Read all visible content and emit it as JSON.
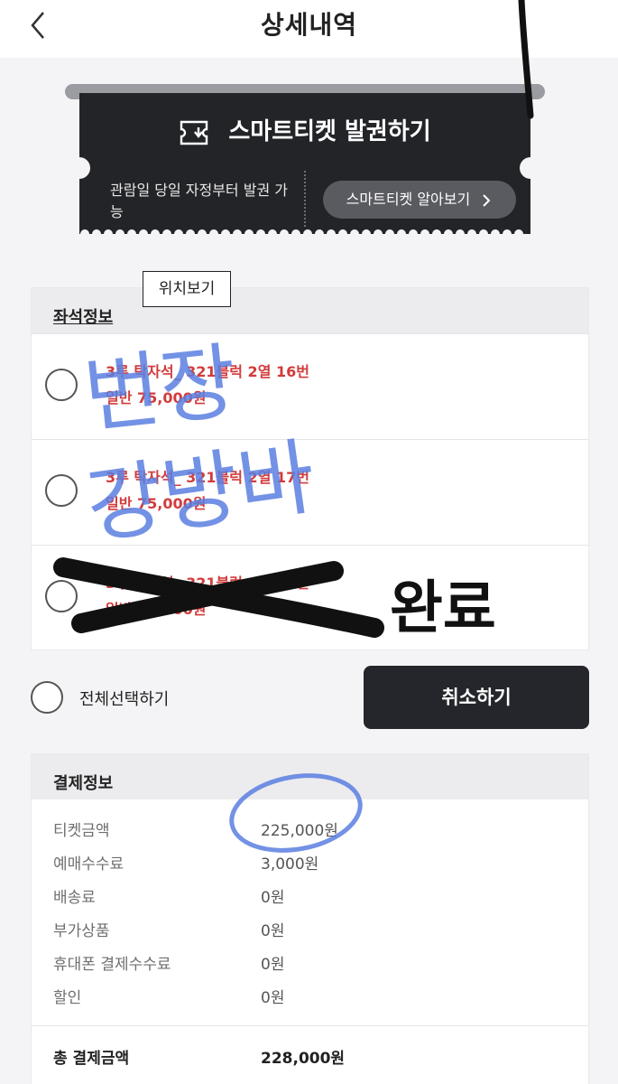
{
  "header": {
    "title": "상세내역",
    "back_icon": "chevron-left-icon"
  },
  "ticket": {
    "issue_label": "스마트티켓 발권하기",
    "issue_icon": "ticket-icon",
    "note": "관람일 당일 자정부터 발권 가능",
    "guide_label": "스마트티켓 알아보기",
    "guide_icon": "chevron-right-icon"
  },
  "seat": {
    "section_title": "좌석정보",
    "tooltip": "위치보기",
    "items": [
      {
        "line1": "3루 탁자석_ 321블럭 2열 16번",
        "line2": "일반 75,000원"
      },
      {
        "line1": "3루 탁자석_ 321블럭 2열 17번",
        "line2": "일반 75,000원"
      },
      {
        "line1": "3루 탁자석_ 321블럭 2열 18번",
        "line2": "일반 75,000원"
      }
    ],
    "select_all": "전체선택하기",
    "cancel": "취소하기"
  },
  "payment": {
    "section_title": "결제정보",
    "rows": [
      {
        "label": "티켓금액",
        "value": "225,000원"
      },
      {
        "label": "예매수수료",
        "value": "3,000원"
      },
      {
        "label": "배송료",
        "value": "0원"
      },
      {
        "label": "부가상품",
        "value": "0원"
      },
      {
        "label": "휴대폰 결제수수료",
        "value": "0원"
      },
      {
        "label": "할인",
        "value": "0원"
      }
    ],
    "total_label": "총 결제금액",
    "total_value": "228,000원"
  },
  "annotations": {
    "handwritten_top": "번장",
    "handwritten_bottom": "강방바",
    "handwritten_done": "완료"
  },
  "colors": {
    "ticket_bg": "#232428",
    "seat_text": "#d23b3b",
    "button_bg": "#25262b",
    "handwriting_blue": "#5b7fe0",
    "marker_black": "#111111"
  }
}
